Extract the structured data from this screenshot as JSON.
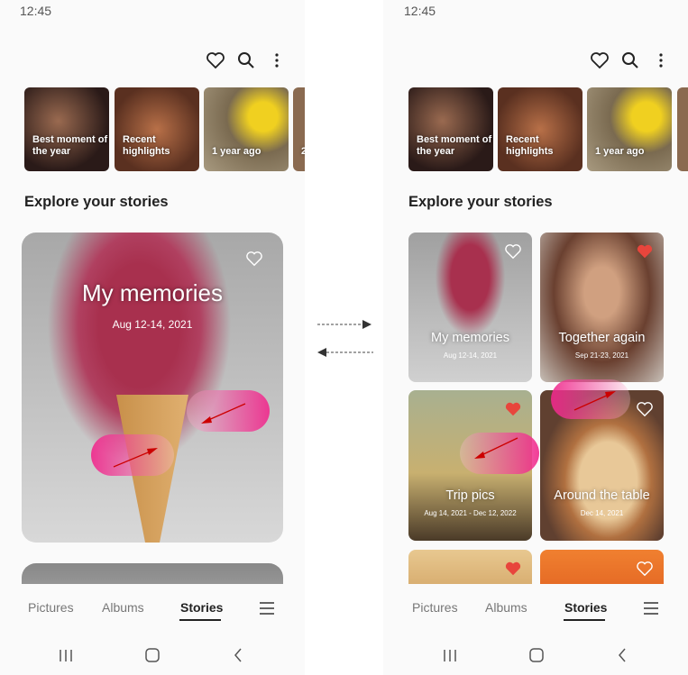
{
  "status_time": "12:45",
  "toolbar": {
    "icons": [
      "heart-outline-icon",
      "search-icon",
      "more-vertical-icon"
    ]
  },
  "highlights": [
    {
      "label": "Best moment of the year"
    },
    {
      "label": "Recent highlights"
    },
    {
      "label": "1 year ago"
    },
    {
      "label": "2"
    }
  ],
  "section_title": "Explore your stories",
  "left_story": {
    "title": "My memories",
    "date": "Aug 12-14, 2021",
    "favorite": false
  },
  "stories": [
    {
      "title": "My memories",
      "date": "Aug 12-14, 2021",
      "favorite": false
    },
    {
      "title": "Together again",
      "date": "Sep 21-23, 2021",
      "favorite": true
    },
    {
      "title": "Trip pics",
      "date": "Aug 14, 2021 - Dec 12, 2022",
      "favorite": true
    },
    {
      "title": "Around the table",
      "date": "Dec 14, 2021",
      "favorite": false
    },
    {
      "title": "",
      "date": "",
      "favorite": true
    },
    {
      "title": "",
      "date": "",
      "favorite": false
    }
  ],
  "bottom_nav": {
    "items": [
      "Pictures",
      "Albums",
      "Stories"
    ],
    "active": "Stories",
    "menu_icon": "hamburger-icon"
  },
  "system_nav": [
    "recents-icon",
    "home-icon",
    "back-icon"
  ],
  "colors": {
    "favorite": "#e8453c",
    "gesture": "#f0288c",
    "active_tab": "#222222"
  }
}
